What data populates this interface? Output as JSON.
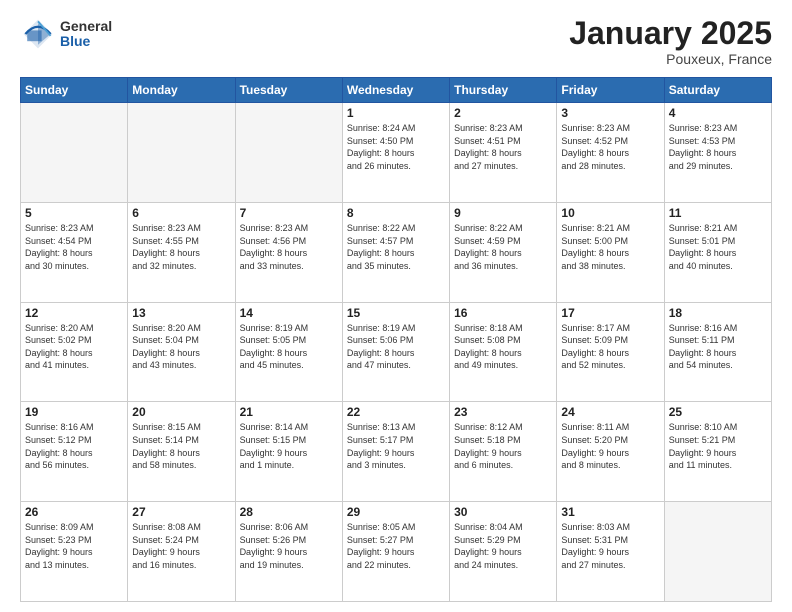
{
  "header": {
    "logo_general": "General",
    "logo_blue": "Blue",
    "month_title": "January 2025",
    "location": "Pouxeux, France"
  },
  "days_of_week": [
    "Sunday",
    "Monday",
    "Tuesday",
    "Wednesday",
    "Thursday",
    "Friday",
    "Saturday"
  ],
  "weeks": [
    [
      {
        "day": "",
        "info": ""
      },
      {
        "day": "",
        "info": ""
      },
      {
        "day": "",
        "info": ""
      },
      {
        "day": "1",
        "info": "Sunrise: 8:24 AM\nSunset: 4:50 PM\nDaylight: 8 hours\nand 26 minutes."
      },
      {
        "day": "2",
        "info": "Sunrise: 8:23 AM\nSunset: 4:51 PM\nDaylight: 8 hours\nand 27 minutes."
      },
      {
        "day": "3",
        "info": "Sunrise: 8:23 AM\nSunset: 4:52 PM\nDaylight: 8 hours\nand 28 minutes."
      },
      {
        "day": "4",
        "info": "Sunrise: 8:23 AM\nSunset: 4:53 PM\nDaylight: 8 hours\nand 29 minutes."
      }
    ],
    [
      {
        "day": "5",
        "info": "Sunrise: 8:23 AM\nSunset: 4:54 PM\nDaylight: 8 hours\nand 30 minutes."
      },
      {
        "day": "6",
        "info": "Sunrise: 8:23 AM\nSunset: 4:55 PM\nDaylight: 8 hours\nand 32 minutes."
      },
      {
        "day": "7",
        "info": "Sunrise: 8:23 AM\nSunset: 4:56 PM\nDaylight: 8 hours\nand 33 minutes."
      },
      {
        "day": "8",
        "info": "Sunrise: 8:22 AM\nSunset: 4:57 PM\nDaylight: 8 hours\nand 35 minutes."
      },
      {
        "day": "9",
        "info": "Sunrise: 8:22 AM\nSunset: 4:59 PM\nDaylight: 8 hours\nand 36 minutes."
      },
      {
        "day": "10",
        "info": "Sunrise: 8:21 AM\nSunset: 5:00 PM\nDaylight: 8 hours\nand 38 minutes."
      },
      {
        "day": "11",
        "info": "Sunrise: 8:21 AM\nSunset: 5:01 PM\nDaylight: 8 hours\nand 40 minutes."
      }
    ],
    [
      {
        "day": "12",
        "info": "Sunrise: 8:20 AM\nSunset: 5:02 PM\nDaylight: 8 hours\nand 41 minutes."
      },
      {
        "day": "13",
        "info": "Sunrise: 8:20 AM\nSunset: 5:04 PM\nDaylight: 8 hours\nand 43 minutes."
      },
      {
        "day": "14",
        "info": "Sunrise: 8:19 AM\nSunset: 5:05 PM\nDaylight: 8 hours\nand 45 minutes."
      },
      {
        "day": "15",
        "info": "Sunrise: 8:19 AM\nSunset: 5:06 PM\nDaylight: 8 hours\nand 47 minutes."
      },
      {
        "day": "16",
        "info": "Sunrise: 8:18 AM\nSunset: 5:08 PM\nDaylight: 8 hours\nand 49 minutes."
      },
      {
        "day": "17",
        "info": "Sunrise: 8:17 AM\nSunset: 5:09 PM\nDaylight: 8 hours\nand 52 minutes."
      },
      {
        "day": "18",
        "info": "Sunrise: 8:16 AM\nSunset: 5:11 PM\nDaylight: 8 hours\nand 54 minutes."
      }
    ],
    [
      {
        "day": "19",
        "info": "Sunrise: 8:16 AM\nSunset: 5:12 PM\nDaylight: 8 hours\nand 56 minutes."
      },
      {
        "day": "20",
        "info": "Sunrise: 8:15 AM\nSunset: 5:14 PM\nDaylight: 8 hours\nand 58 minutes."
      },
      {
        "day": "21",
        "info": "Sunrise: 8:14 AM\nSunset: 5:15 PM\nDaylight: 9 hours\nand 1 minute."
      },
      {
        "day": "22",
        "info": "Sunrise: 8:13 AM\nSunset: 5:17 PM\nDaylight: 9 hours\nand 3 minutes."
      },
      {
        "day": "23",
        "info": "Sunrise: 8:12 AM\nSunset: 5:18 PM\nDaylight: 9 hours\nand 6 minutes."
      },
      {
        "day": "24",
        "info": "Sunrise: 8:11 AM\nSunset: 5:20 PM\nDaylight: 9 hours\nand 8 minutes."
      },
      {
        "day": "25",
        "info": "Sunrise: 8:10 AM\nSunset: 5:21 PM\nDaylight: 9 hours\nand 11 minutes."
      }
    ],
    [
      {
        "day": "26",
        "info": "Sunrise: 8:09 AM\nSunset: 5:23 PM\nDaylight: 9 hours\nand 13 minutes."
      },
      {
        "day": "27",
        "info": "Sunrise: 8:08 AM\nSunset: 5:24 PM\nDaylight: 9 hours\nand 16 minutes."
      },
      {
        "day": "28",
        "info": "Sunrise: 8:06 AM\nSunset: 5:26 PM\nDaylight: 9 hours\nand 19 minutes."
      },
      {
        "day": "29",
        "info": "Sunrise: 8:05 AM\nSunset: 5:27 PM\nDaylight: 9 hours\nand 22 minutes."
      },
      {
        "day": "30",
        "info": "Sunrise: 8:04 AM\nSunset: 5:29 PM\nDaylight: 9 hours\nand 24 minutes."
      },
      {
        "day": "31",
        "info": "Sunrise: 8:03 AM\nSunset: 5:31 PM\nDaylight: 9 hours\nand 27 minutes."
      },
      {
        "day": "",
        "info": ""
      }
    ]
  ]
}
